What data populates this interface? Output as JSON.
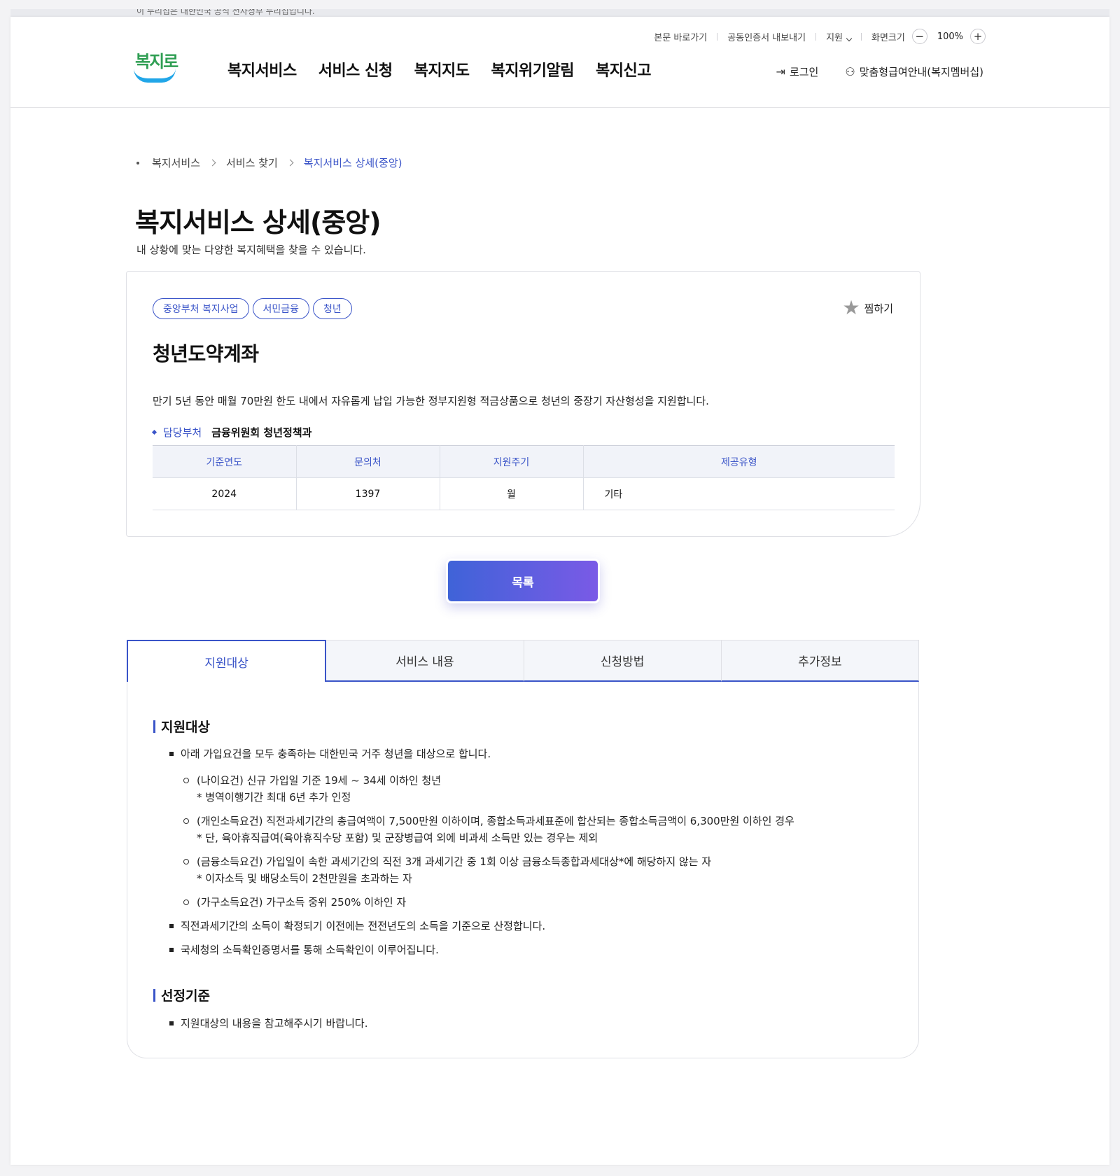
{
  "top_strip_text": "이 누리집은 대한민국 공식 전자정부 누리집입니다.",
  "util": {
    "skip": "본문 바로가기",
    "cert": "공동인증서 내보내기",
    "lang": "지원",
    "size_label": "화면크기",
    "zoom": "100%",
    "minus": "−",
    "plus": "+"
  },
  "logo_text": "복지로",
  "gnb": [
    "복지서비스",
    "서비스 신청",
    "복지지도",
    "복지위기알림",
    "복지신고"
  ],
  "header_right": {
    "login": "로그인",
    "membership": "맞춤형급여안내(복지멤버십)"
  },
  "breadcrumb": [
    "복지서비스",
    "서비스 찾기",
    "복지서비스 상세(중앙)"
  ],
  "page_title": "복지서비스 상세(중앙)",
  "page_subtitle": "내 상황에 맞는 다양한 복지혜택을 찾을 수 있습니다.",
  "card": {
    "tags": [
      "중앙부처 복지사업",
      "서민금융",
      "청년"
    ],
    "fav": "찜하기",
    "title": "청년도약계좌",
    "desc": "만기 5년 동안 매월 70만원 한도 내에서 자유롭게 납입 가능한 정부지원형 적금상품으로 청년의 중장기 자산형성을 지원합니다.",
    "dept_label": "담당부처",
    "dept_value": "금융위원회 청년정책과",
    "table_headers": [
      "기준연도",
      "문의처",
      "지원주기",
      "제공유형"
    ],
    "table_values": [
      "2024",
      "1397",
      "월",
      "기타"
    ]
  },
  "list_button": "목록",
  "tabs": [
    "지원대상",
    "서비스 내용",
    "신청방법",
    "추가정보"
  ],
  "panel": {
    "section1": "지원대상",
    "s1_item1": "아래 가입요건을 모두 충족하는 대한민국 거주 청년을 대상으로 합니다.",
    "sub1": "(나이요건) 신규 가입일 기준 19세 ~ 34세 이하인 청년",
    "sub1_note": "* 병역이행기간 최대 6년 추가 인정",
    "sub2": "(개인소득요건) 직전과세기간의 총급여액이 7,500만원 이하이며, 종합소득과세표준에 합산되는 종합소득금액이 6,300만원 이하인 경우",
    "sub2_note": "* 단, 육아휴직급여(육아휴직수당 포함) 및 군장병급여 외에 비과세 소득만 있는 경우는 제외",
    "sub3": "(금융소득요건) 가입일이 속한 과세기간의 직전 3개 과세기간 중 1회 이상 금융소득종합과세대상*에 해당하지 않는 자",
    "sub3_note": "* 이자소득 및 배당소득이 2천만원을 초과하는 자",
    "sub4": "(가구소득요건) 가구소득 중위 250% 이하인 자",
    "s1_item2": "직전과세기간의 소득이 확정되기 이전에는 전전년도의 소득을 기준으로 산정합니다.",
    "s1_item3": "국세청의 소득확인증명서를 통해 소득확인이 이루어집니다.",
    "section2": "선정기준",
    "s2_item1": "지원대상의 내용을 참고해주시기 바랍니다."
  }
}
